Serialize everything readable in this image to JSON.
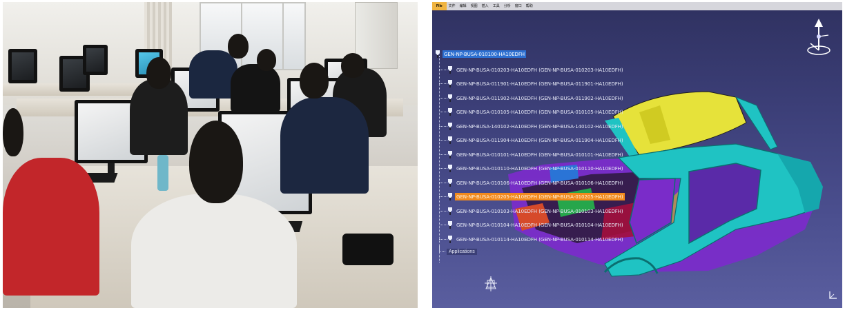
{
  "cad": {
    "menubar": [
      "File",
      "文件",
      "编辑",
      "视图",
      "插入",
      "工具",
      "分析",
      "窗口",
      "帮助"
    ],
    "tree": {
      "root": "GEN-NP-BUSA-010100-HA10EDFH",
      "items": [
        "GEN-NP-BUSA-010203-HA10EDFH (GEN-NP-BUSA-010203-HA10EDFH)",
        "GEN-NP-BUSA-011901-HA10EDFH (GEN-NP-BUSA-011901-HA10EDFH)",
        "GEN-NP-BUSA-011902-HA10EDFH (GEN-NP-BUSA-011902-HA10EDFH)",
        "GEN-NP-BUSA-010105-HA10EDFH (GEN-NP-BUSA-010105-HA10EDFH)",
        "GEN-NP-BUSA-140102-HA10EDFH (GEN-NP-BUSA-140102-HA10EDFH)",
        "GEN-NP-BUSA-011904-HA10EDFH (GEN-NP-BUSA-011904-HA10EDFH)",
        "GEN-NP-BUSA-010101-HA10EDFH (GEN-NP-BUSA-010101-HA10EDFH)",
        "GEN-NP-BUSA-010110-HA10EDFH (GEN-NP-BUSA-010110-HA10EDFH)",
        "GEN-NP-BUSA-010106-HA10EDFH (GEN-NP-BUSA-010106-HA10EDFH)",
        "GEN-NP-BUSA-010205-HA10EDFH (GEN-NP-BUSA-010205-HA10EDFH)",
        "GEN-NP-BUSA-010103-HA10EDFH (GEN-NP-BUSA-010103-HA10EDFH)",
        "GEN-NP-BUSA-010104-HA10EDFH (GEN-NP-BUSA-010104-HA10EDFH)",
        "GEN-NP-BUSA-010114-HA10EDFH (GEN-NP-BUSA-010114-HA10EDFH)"
      ],
      "selected_item": 9,
      "applications": "Applications"
    },
    "colors": {
      "selection": "#f28a1d",
      "root_highlight": "#2d6fd0",
      "car_body": "#1fc3c3",
      "roof": "#e6e23a",
      "interior": "#7a2cc9"
    }
  }
}
